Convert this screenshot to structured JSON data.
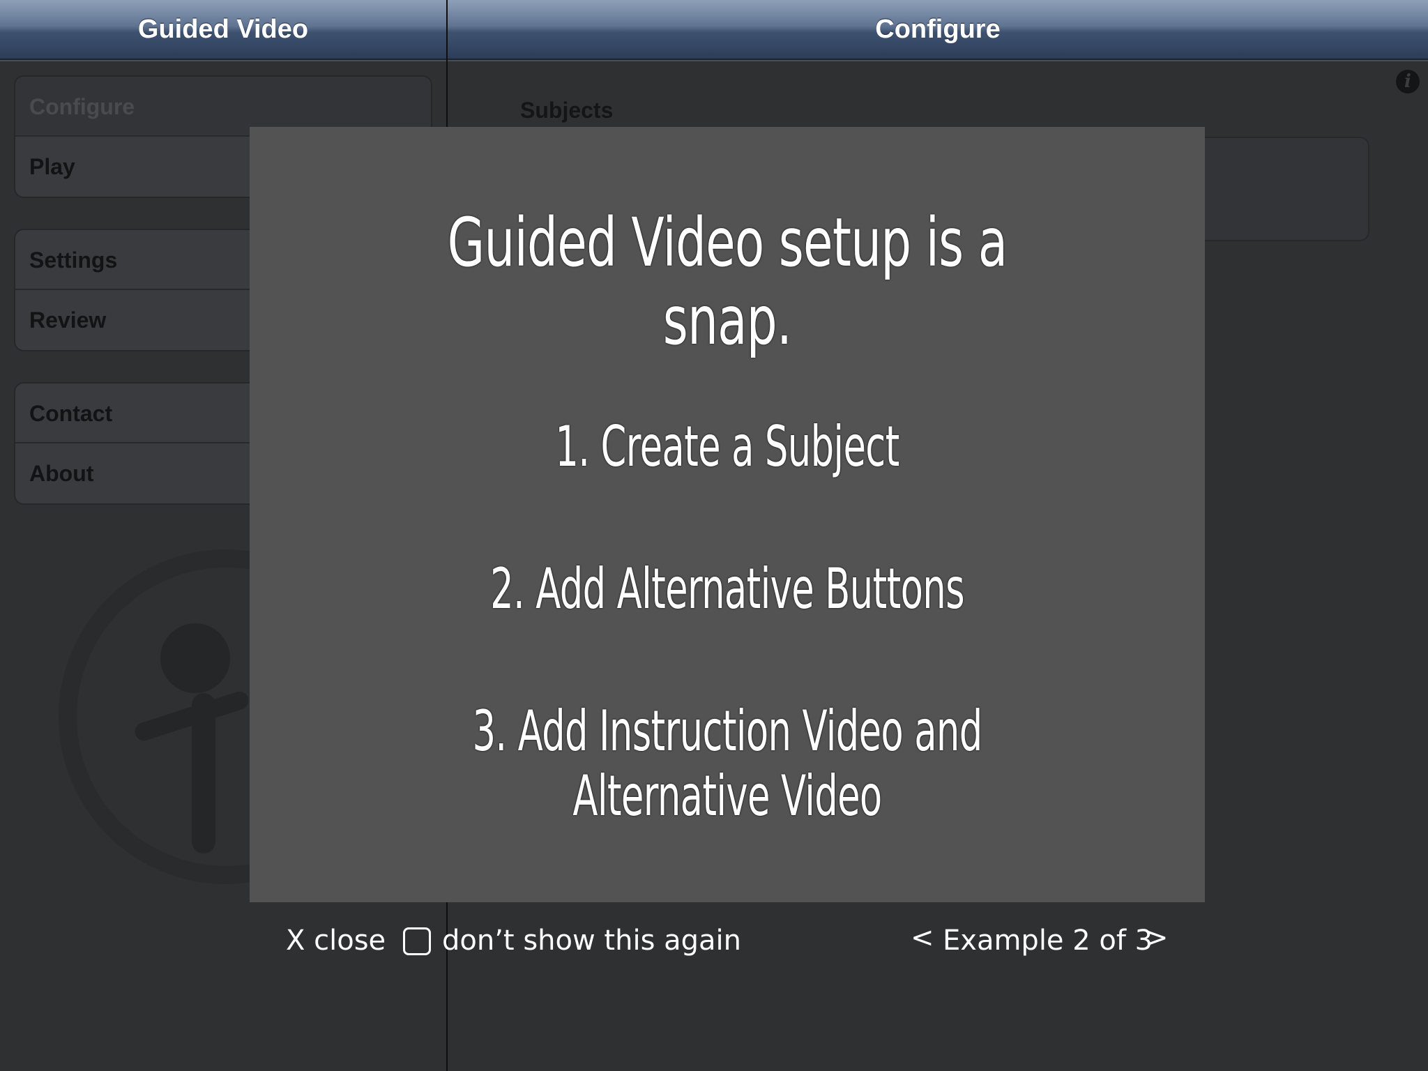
{
  "master": {
    "nav_title": "Guided Video",
    "groups": [
      [
        "Configure",
        "Play"
      ],
      [
        "Settings",
        "Review"
      ],
      [
        "Contact",
        "About"
      ]
    ]
  },
  "detail": {
    "nav_title": "Configure",
    "section_header": "Subjects",
    "info_icon": "info-icon"
  },
  "overlay": {
    "headline": "Guided Video setup is a snap.",
    "steps": [
      "1. Create a Subject",
      "2. Add Alternative Buttons",
      "3. Add Instruction Video and Alternative Video"
    ],
    "close_label": "X close",
    "dont_show_label": "don’t show this again",
    "dont_show_checked": false,
    "prev_label": "<",
    "next_label": ">",
    "example_label": "Example 2 of 3"
  },
  "colors": {
    "nav_bar": "#4a5d7c",
    "panel_bg": "#2f3032",
    "card_bg": "#535353",
    "overlay_text": "#ffffff"
  }
}
